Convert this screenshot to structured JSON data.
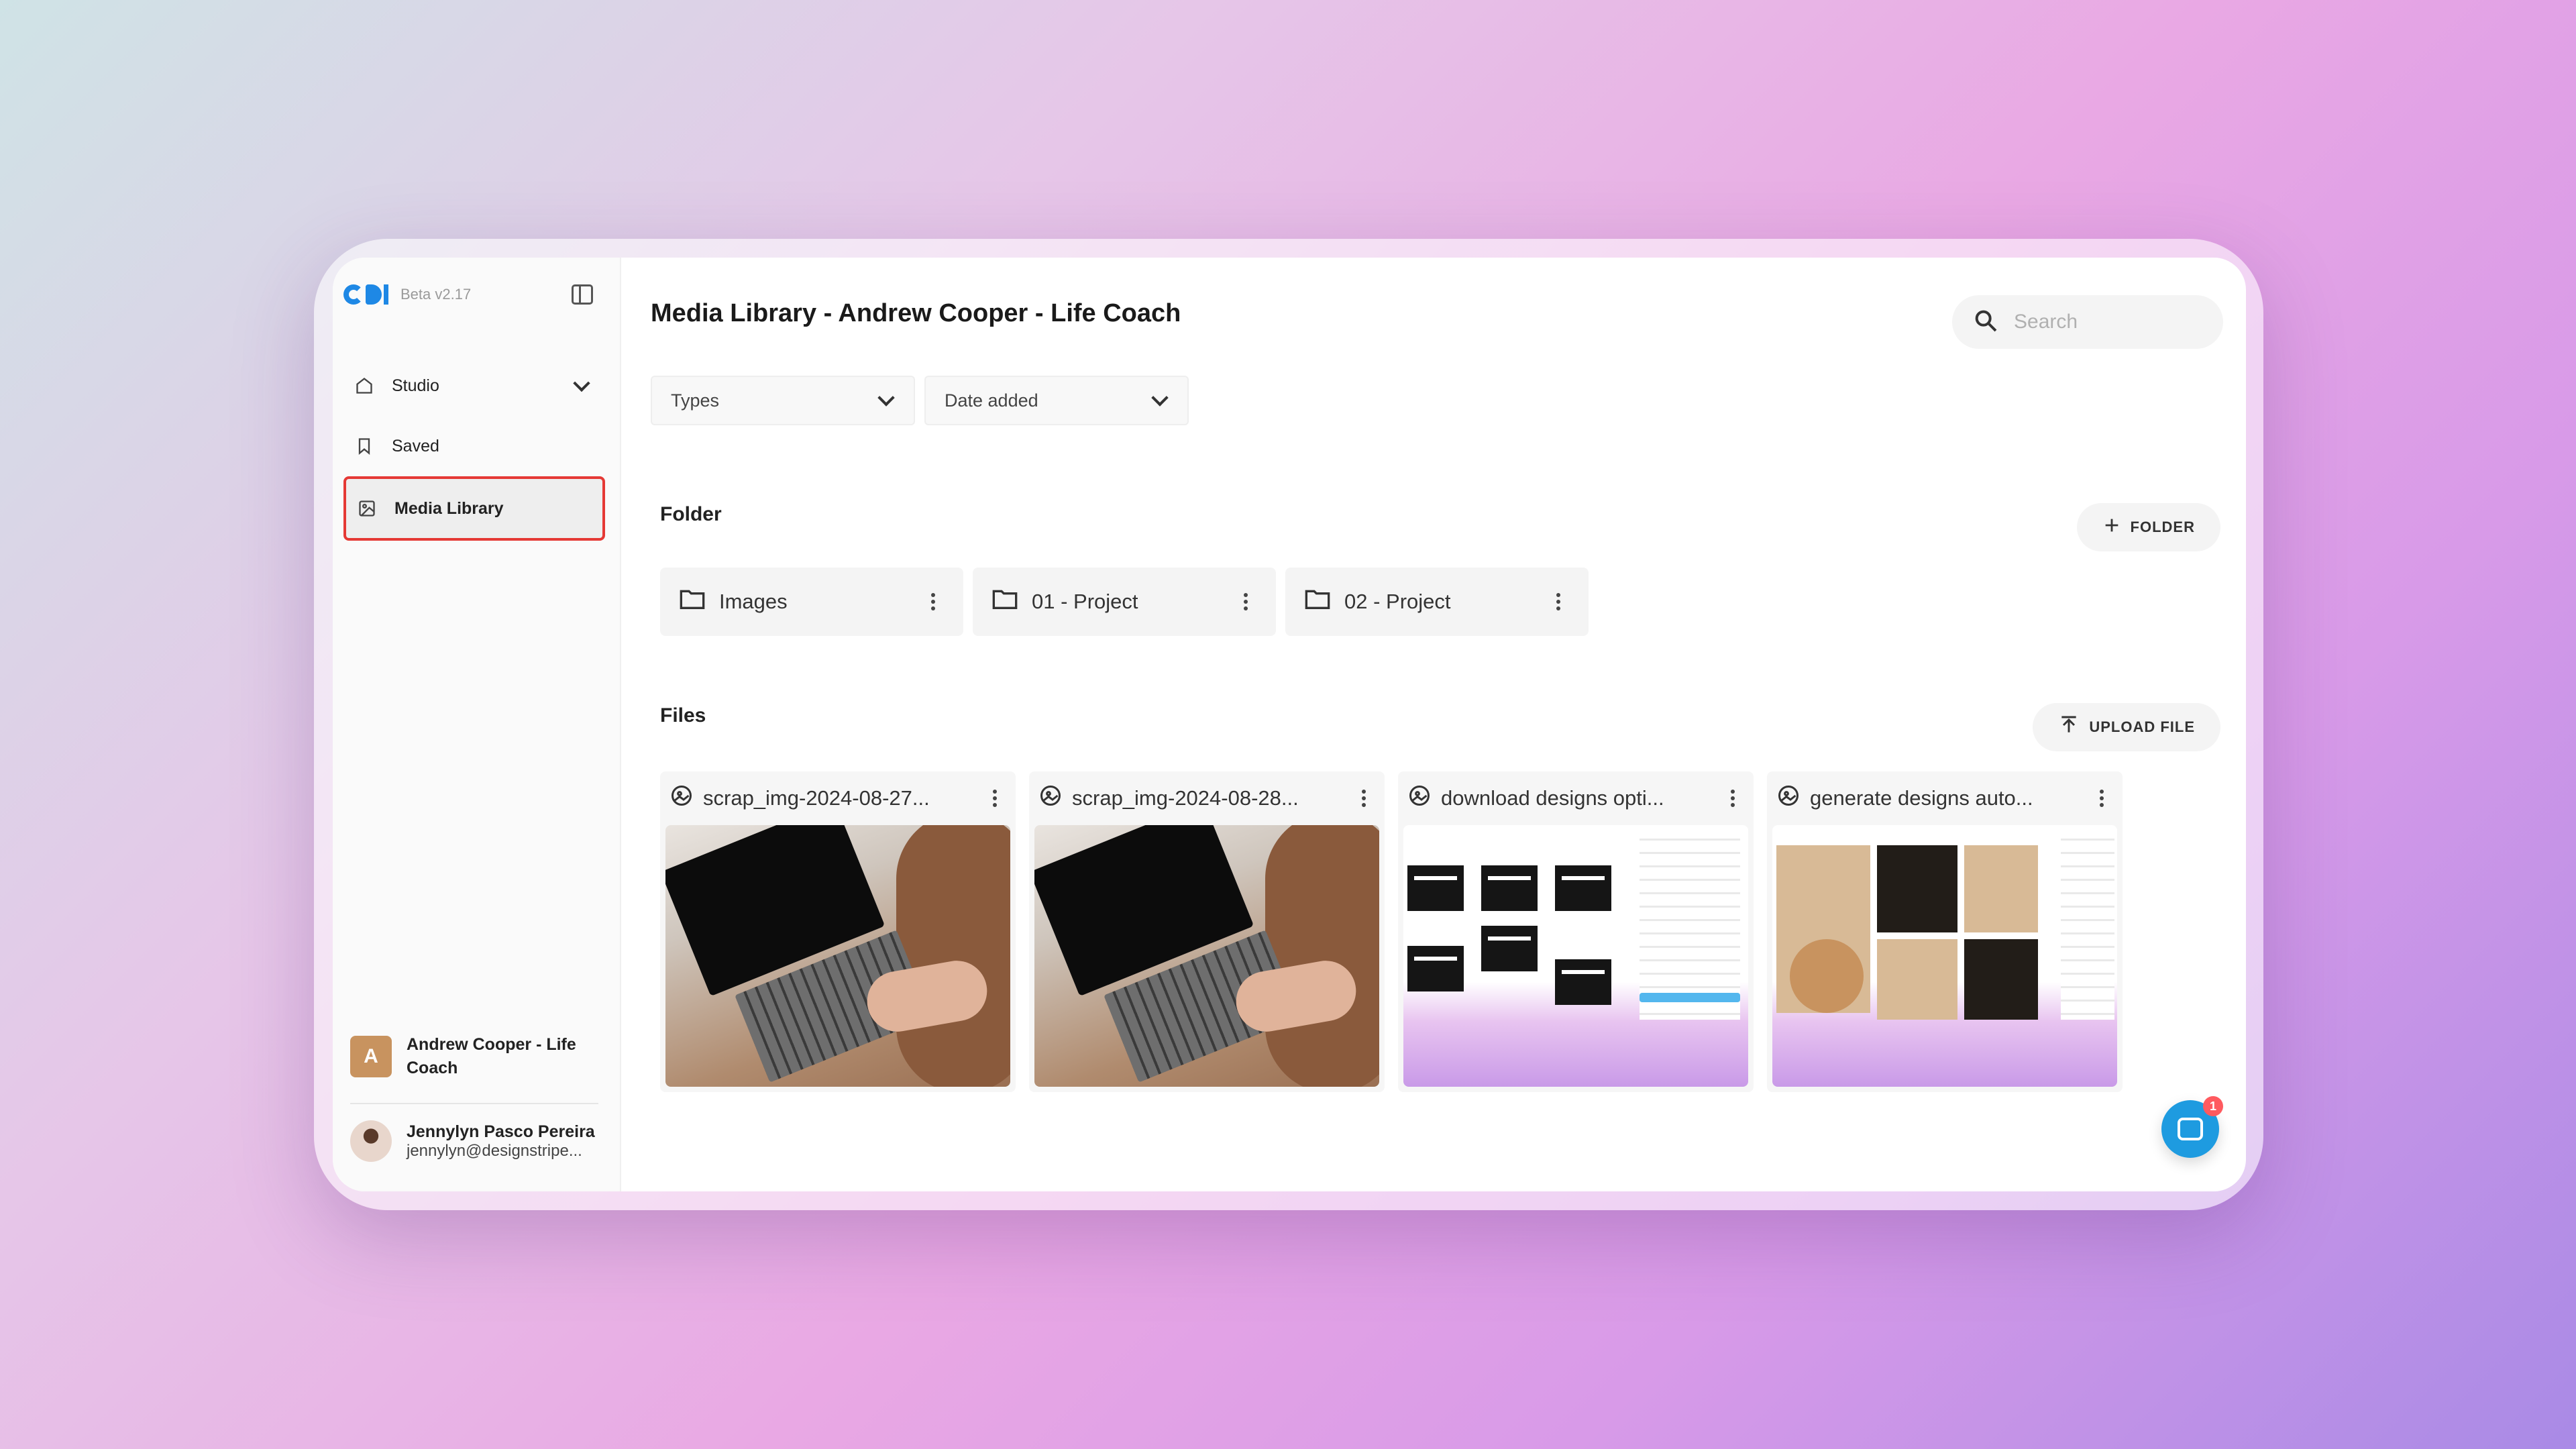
{
  "app": {
    "version_label": "Beta v2.17"
  },
  "sidebar": {
    "items": [
      {
        "label": "Studio",
        "icon": "home-icon"
      },
      {
        "label": "Saved",
        "icon": "bookmark-icon"
      },
      {
        "label": "Media Library",
        "icon": "image-icon"
      }
    ],
    "account": {
      "initial": "A",
      "name": "Andrew Cooper - Life Coach"
    },
    "user": {
      "name": "Jennylyn Pasco Pereira",
      "email": "jennylyn@designstripe..."
    }
  },
  "header": {
    "title": "Media Library - Andrew Cooper - Life Coach",
    "search_placeholder": "Search"
  },
  "filters": {
    "types": "Types",
    "date": "Date added"
  },
  "folders": {
    "heading": "Folder",
    "add_label": "FOLDER",
    "items": [
      {
        "label": "Images"
      },
      {
        "label": "01 - Project"
      },
      {
        "label": "02 - Project"
      }
    ]
  },
  "files": {
    "heading": "Files",
    "upload_label": "UPLOAD FILE",
    "items": [
      {
        "name": "scrap_img-2024-08-27..."
      },
      {
        "name": "scrap_img-2024-08-28..."
      },
      {
        "name": "download designs opti..."
      },
      {
        "name": "generate designs auto..."
      }
    ]
  },
  "chat": {
    "badge": "1"
  },
  "colors": {
    "accent": "#1e88e5",
    "highlight_border": "#e53935",
    "chat": "#1e9be0"
  }
}
